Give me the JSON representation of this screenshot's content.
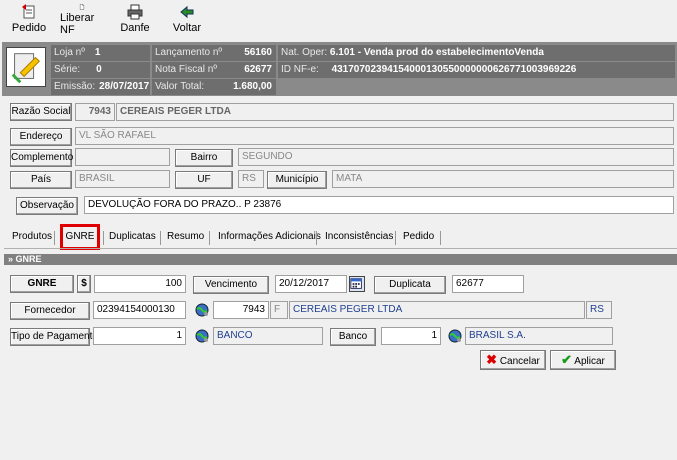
{
  "toolbar": {
    "pedido": "Pedido",
    "liberar": "Liberar NF",
    "danfe": "Danfe",
    "voltar": "Voltar"
  },
  "info": {
    "loja_label": "Loja nº",
    "loja": "1",
    "serie_label": "Série:",
    "serie": "0",
    "emissao_label": "Emissão:",
    "emissao": "28/07/2017",
    "lanc_label": "Lançamento nº",
    "lanc": "56160",
    "nf_label": "Nota Fiscal nº",
    "nf": "62677",
    "valor_label": "Valor Total:",
    "valor": "1.680,00",
    "natoper_label": "Nat. Oper:",
    "natoper": "6.101 - Venda prod do estabelecimentoVenda",
    "idnfe_label": "ID NF-e:",
    "idnfe": "43170702394154000130550000000626771003969226"
  },
  "form": {
    "razao_label": "Razão Social",
    "razao_code": "7943",
    "razao": "CEREAIS PEGER LTDA",
    "endereco_label": "Endereço",
    "endereco": "VL SÃO RAFAEL",
    "complemento_label": "Complemento",
    "complemento": "",
    "bairro_label": "Bairro",
    "bairro": "SEGUNDO",
    "pais_label": "País",
    "pais": "BRASIL",
    "uf_label": "UF",
    "uf": "RS",
    "municipio_label": "Município",
    "municipio": "MATA",
    "obs_label": "Observação",
    "obs": "DEVOLUÇÃO FORA DO PRAZO.. P 23876"
  },
  "tabs": [
    "Produtos",
    "GNRE",
    "Duplicatas",
    "Resumo",
    "Informações Adicionais",
    "Inconsistências",
    "Pedido"
  ],
  "gnre": {
    "section": "» GNRE",
    "gnre_label": "GNRE",
    "currency": "$",
    "valor": "100",
    "venc_label": "Vencimento",
    "venc": "20/12/2017",
    "dup_label": "Duplicata",
    "dup": "62677",
    "forn_label": "Fornecedor",
    "forn_cnpj": "02394154000130",
    "forn_code": "7943",
    "forn_f": "F",
    "forn_name": "CEREAIS PEGER LTDA",
    "forn_uf": "RS",
    "tipo_label": "Tipo de Pagamento",
    "tipo_code": "1",
    "tipo_name": "BANCO",
    "banco_label": "Banco",
    "banco_code": "1",
    "banco_name": "BRASIL S.A."
  },
  "actions": {
    "cancel": "Cancelar",
    "apply": "Aplicar"
  },
  "colors": {
    "highlight": "#e00000",
    "panel": "#8a8a8a"
  }
}
